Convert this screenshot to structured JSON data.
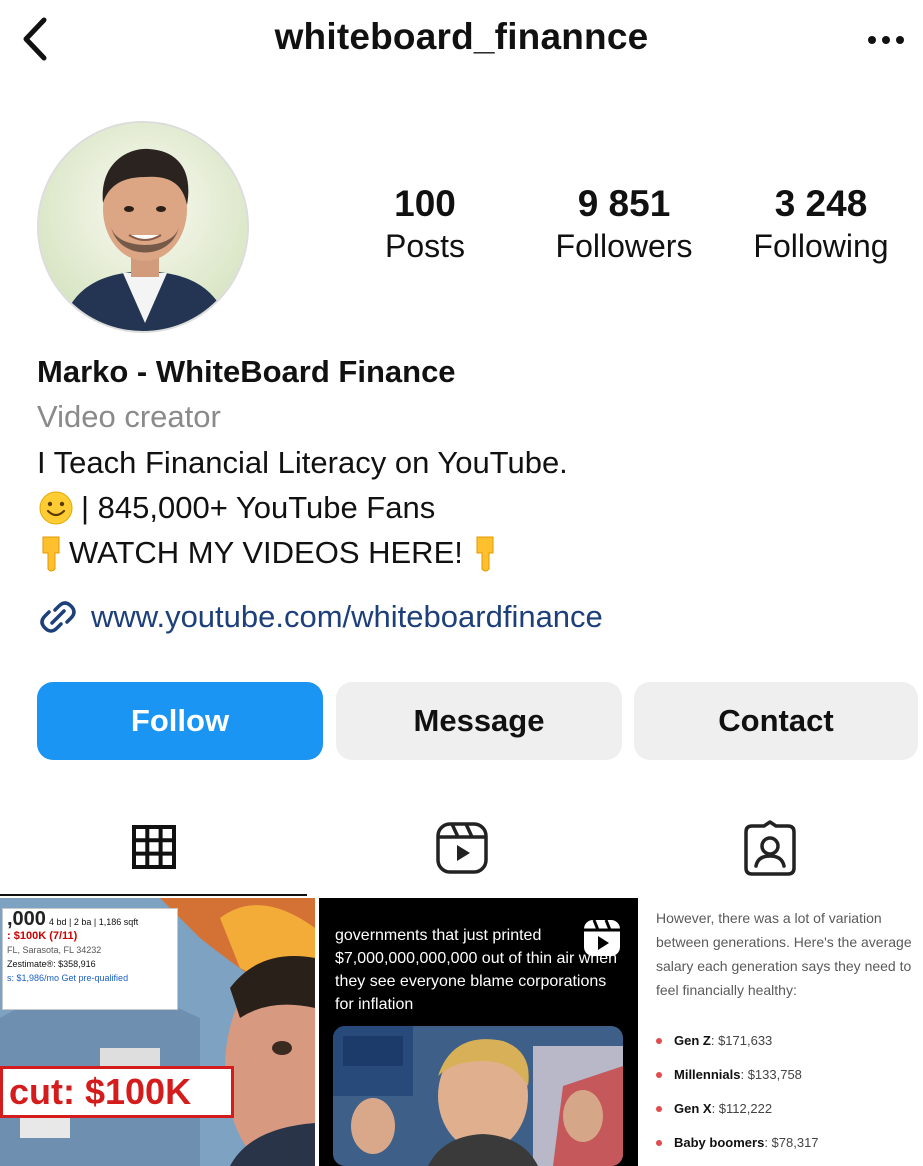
{
  "header": {
    "username": "whiteboard_finannce",
    "back_icon": "chevron-left-icon",
    "more_icon": "ellipsis-icon"
  },
  "stats": {
    "posts": {
      "value": "100",
      "label": "Posts"
    },
    "followers": {
      "value": "9 851",
      "label": "Followers"
    },
    "following": {
      "value": "3 248",
      "label": "Following"
    }
  },
  "bio": {
    "name": "Marko - WhiteBoard Finance",
    "category": "Video creator",
    "line1": "I Teach Financial Literacy on YouTube.",
    "line2": "| 845,000+ YouTube Fans",
    "line3": "WATCH MY VIDEOS HERE!",
    "link": "www.youtube.com/whiteboardfinance"
  },
  "actions": {
    "follow": "Follow",
    "message": "Message",
    "contact": "Contact"
  },
  "tabs": {
    "grid_icon": "grid-icon",
    "reels_icon": "reels-icon",
    "tagged_icon": "tagged-icon",
    "active": "grid"
  },
  "posts": {
    "tile1": {
      "price": ",000",
      "specs": "4 bd | 2 ba | 1,186 sqft",
      "cut_tag": ": $100K (7/11)",
      "address": "FL, Sarasota, FL 34232",
      "zestimate": "Zestimate®: $358,916",
      "payment": "s: $1,986/mo  Get pre-qualified",
      "headline": "cut: $100K"
    },
    "tile2": {
      "caption": "governments that just printed $7,000,000,000,000 out of thin air when they see everyone blame corporations for inflation"
    },
    "tile3": {
      "intro": "However, there was a lot of variation between generations. Here's the average salary each generation says they need to feel financially healthy:",
      "items": [
        {
          "label": "Gen Z",
          "value": ": $171,633"
        },
        {
          "label": "Millennials",
          "value": ": $133,758"
        },
        {
          "label": "Gen X",
          "value": ": $112,222"
        },
        {
          "label": "Baby boomers",
          "value": ": $78,317"
        }
      ]
    }
  },
  "colors": {
    "follow_button": "#1a95f4",
    "secondary_button": "#efefef",
    "link_text": "#1d3f7a",
    "muted_text": "#8a8a8a",
    "price_cut_red": "#d41c1c"
  }
}
